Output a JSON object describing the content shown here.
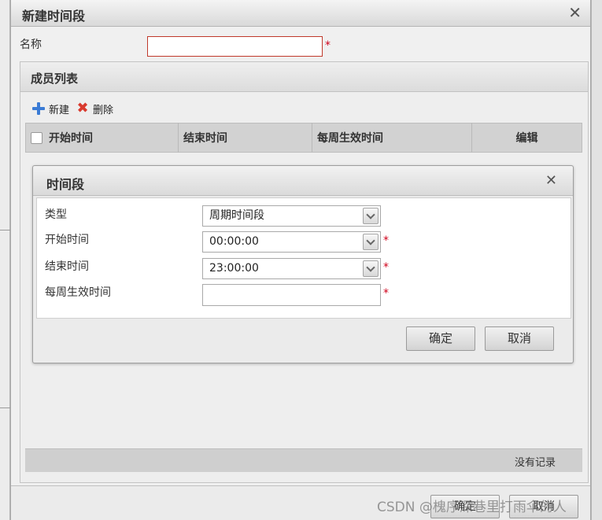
{
  "outer_dialog": {
    "title": "新建时间段",
    "close_symbol": "✕",
    "name_label": "名称",
    "name_value": "",
    "required_mark": "*",
    "ok_label": "确定",
    "cancel_label": "取消"
  },
  "members": {
    "title": "成员列表",
    "toolbar": {
      "new_label": "新建",
      "delete_label": "删除"
    },
    "columns": [
      "开始时间",
      "结束时间",
      "每周生效时间",
      "编辑"
    ],
    "empty_text": "没有记录"
  },
  "inner_dialog": {
    "title": "时间段",
    "close_symbol": "✕",
    "fields": [
      {
        "label": "类型",
        "value": "周期时间段"
      },
      {
        "label": "开始时间",
        "value": "00:00:00"
      },
      {
        "label": "结束时间",
        "value": "23:00:00"
      },
      {
        "label": "每周生效时间",
        "value": ""
      }
    ],
    "ok_label": "确定",
    "cancel_label": "取消"
  },
  "watermark": "CSDN @槐序深巷里打雨伞的人",
  "colors": {
    "required": "#d0021b",
    "add_icon": "#3a7bd5",
    "delete_icon": "#d93a2e",
    "name_border": "#c0392b"
  }
}
